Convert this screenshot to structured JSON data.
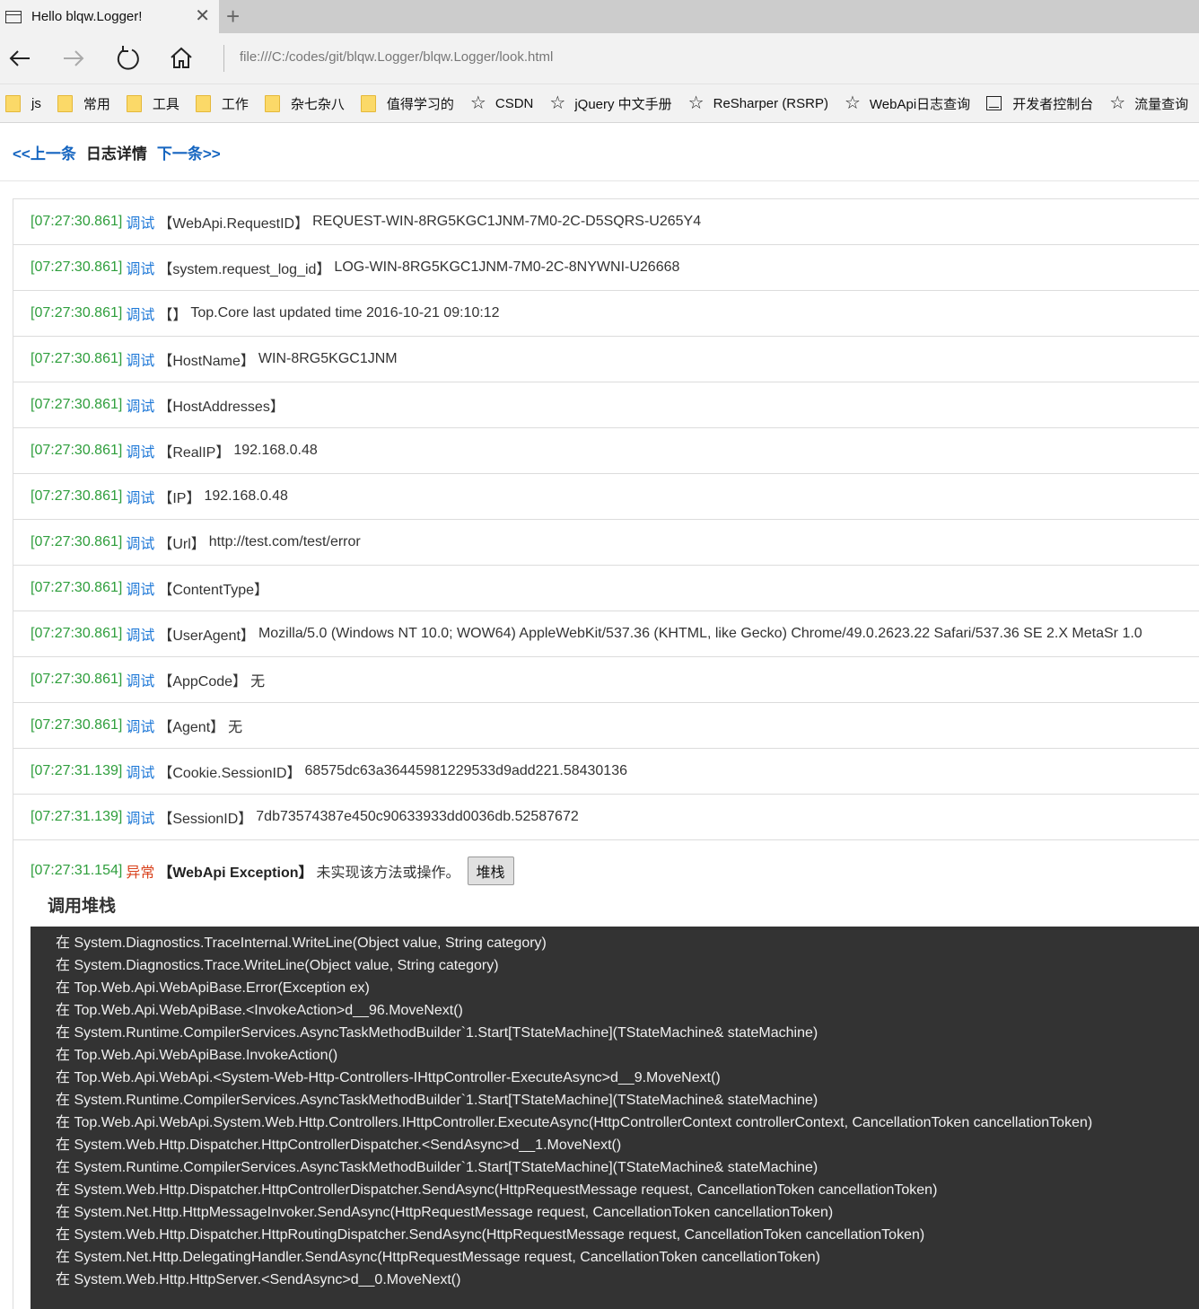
{
  "browser": {
    "tab_title": "Hello blqw.Logger!",
    "address": "file:///C:/codes/git/blqw.Logger/blqw.Logger/look.html",
    "favorites": [
      {
        "type": "folder",
        "label": "js"
      },
      {
        "type": "folder",
        "label": "常用"
      },
      {
        "type": "folder",
        "label": "工具"
      },
      {
        "type": "folder",
        "label": "工作"
      },
      {
        "type": "folder",
        "label": "杂七杂八"
      },
      {
        "type": "folder",
        "label": "值得学习的"
      },
      {
        "type": "star",
        "label": "CSDN"
      },
      {
        "type": "star",
        "label": "jQuery 中文手册"
      },
      {
        "type": "star",
        "label": "ReSharper (RSRP)"
      },
      {
        "type": "star",
        "label": "WebApi日志查询"
      },
      {
        "type": "dev",
        "label": "开发者控制台"
      },
      {
        "type": "star",
        "label": "流量查询"
      },
      {
        "type": "star",
        "label": ""
      }
    ]
  },
  "page_nav": {
    "prev": "<<上一条",
    "title": "日志详情",
    "next": "下一条>>"
  },
  "logs": [
    {
      "time": "[07:27:30.861]",
      "level": "调试",
      "key": "【WebApi.RequestID】",
      "value": "REQUEST-WIN-8RG5KGC1JNM-7M0-2C-D5SQRS-U265Y4"
    },
    {
      "time": "[07:27:30.861]",
      "level": "调试",
      "key": "【system.request_log_id】",
      "value": "LOG-WIN-8RG5KGC1JNM-7M0-2C-8NYWNI-U26668"
    },
    {
      "time": "[07:27:30.861]",
      "level": "调试",
      "key": "【】",
      "value": "Top.Core last updated time 2016-10-21 09:10:12"
    },
    {
      "time": "[07:27:30.861]",
      "level": "调试",
      "key": "【HostName】",
      "value": "WIN-8RG5KGC1JNM"
    },
    {
      "time": "[07:27:30.861]",
      "level": "调试",
      "key": "【HostAddresses】",
      "value": ""
    },
    {
      "time": "[07:27:30.861]",
      "level": "调试",
      "key": "【RealIP】",
      "value": "192.168.0.48"
    },
    {
      "time": "[07:27:30.861]",
      "level": "调试",
      "key": "【IP】",
      "value": "192.168.0.48"
    },
    {
      "time": "[07:27:30.861]",
      "level": "调试",
      "key": "【Url】",
      "value": "http://test.com/test/error"
    },
    {
      "time": "[07:27:30.861]",
      "level": "调试",
      "key": "【ContentType】",
      "value": ""
    },
    {
      "time": "[07:27:30.861]",
      "level": "调试",
      "key": "【UserAgent】",
      "value": "Mozilla/5.0 (Windows NT 10.0; WOW64) AppleWebKit/537.36 (KHTML, like Gecko) Chrome/49.0.2623.22 Safari/537.36 SE 2.X MetaSr 1.0"
    },
    {
      "time": "[07:27:30.861]",
      "level": "调试",
      "key": "【AppCode】",
      "value": "无"
    },
    {
      "time": "[07:27:30.861]",
      "level": "调试",
      "key": "【Agent】",
      "value": "无"
    },
    {
      "time": "[07:27:31.139]",
      "level": "调试",
      "key": "【Cookie.SessionID】",
      "value": "68575dc63a36445981229533d9add221.58430136"
    },
    {
      "time": "[07:27:31.139]",
      "level": "调试",
      "key": "【SessionID】",
      "value": "7db73574387e450c90633933dd0036db.52587672"
    }
  ],
  "exception": {
    "time": "[07:27:31.154]",
    "level": "异常",
    "key": "【WebApi Exception】",
    "message": "未实现该方法或操作。",
    "stack_button": "堆栈",
    "stack_title": "调用堆栈",
    "stack_lines": [
      "在 System.Diagnostics.TraceInternal.WriteLine(Object value, String category)",
      "在 System.Diagnostics.Trace.WriteLine(Object value, String category)",
      "在 Top.Web.Api.WebApiBase.Error(Exception ex)",
      "在 Top.Web.Api.WebApiBase.<InvokeAction>d__96.MoveNext()",
      "在 System.Runtime.CompilerServices.AsyncTaskMethodBuilder`1.Start[TStateMachine](TStateMachine& stateMachine)",
      "在 Top.Web.Api.WebApiBase.InvokeAction()",
      "在 Top.Web.Api.WebApi.<System-Web-Http-Controllers-IHttpController-ExecuteAsync>d__9.MoveNext()",
      "在 System.Runtime.CompilerServices.AsyncTaskMethodBuilder`1.Start[TStateMachine](TStateMachine& stateMachine)",
      "在 Top.Web.Api.WebApi.System.Web.Http.Controllers.IHttpController.ExecuteAsync(HttpControllerContext controllerContext, CancellationToken cancellationToken)",
      "在 System.Web.Http.Dispatcher.HttpControllerDispatcher.<SendAsync>d__1.MoveNext()",
      "在 System.Runtime.CompilerServices.AsyncTaskMethodBuilder`1.Start[TStateMachine](TStateMachine& stateMachine)",
      "在 System.Web.Http.Dispatcher.HttpControllerDispatcher.SendAsync(HttpRequestMessage request, CancellationToken cancellationToken)",
      "在 System.Net.Http.HttpMessageInvoker.SendAsync(HttpRequestMessage request, CancellationToken cancellationToken)",
      "在 System.Web.Http.Dispatcher.HttpRoutingDispatcher.SendAsync(HttpRequestMessage request, CancellationToken cancellationToken)",
      "在 System.Net.Http.DelegatingHandler.SendAsync(HttpRequestMessage request, CancellationToken cancellationToken)",
      "在 System.Web.Http.HttpServer.<SendAsync>d__0.MoveNext()"
    ]
  }
}
